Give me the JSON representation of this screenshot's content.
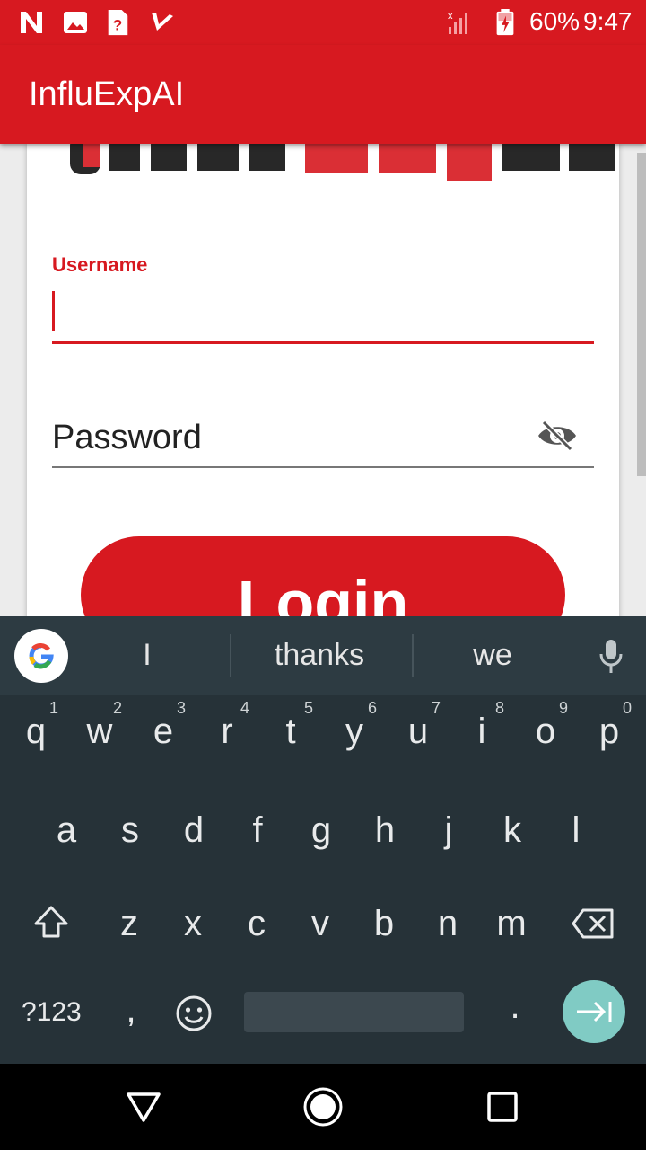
{
  "status_bar": {
    "battery": "60%",
    "time": "9:47",
    "icons": [
      "n-app-icon",
      "image-icon",
      "help-file-icon",
      "check-icon",
      "no-signal-icon",
      "battery-charging-icon"
    ]
  },
  "app_bar": {
    "title": "InfluExpAI"
  },
  "form": {
    "username_label": "Username",
    "username_value": "",
    "password_placeholder": "Password",
    "login_label": "Login"
  },
  "keyboard": {
    "suggestions": [
      "I",
      "thanks",
      "we"
    ],
    "row1": [
      "q",
      "w",
      "e",
      "r",
      "t",
      "y",
      "u",
      "i",
      "o",
      "p"
    ],
    "row1_hints": [
      "1",
      "2",
      "3",
      "4",
      "5",
      "6",
      "7",
      "8",
      "9",
      "0"
    ],
    "row2": [
      "a",
      "s",
      "d",
      "f",
      "g",
      "h",
      "j",
      "k",
      "l"
    ],
    "row3": [
      "z",
      "x",
      "c",
      "v",
      "b",
      "n",
      "m"
    ],
    "symbols_label": "?123",
    "comma": ",",
    "period": ".",
    "accent_color": "#80cbc4"
  },
  "colors": {
    "brand": "#d71920",
    "keyboard_bg": "#263238"
  }
}
